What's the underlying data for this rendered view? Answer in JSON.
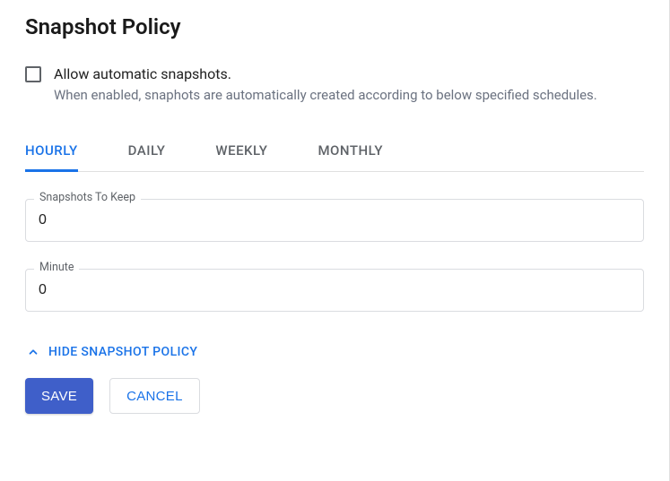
{
  "title": "Snapshot Policy",
  "allow_automatic": {
    "checked": false,
    "label": "Allow automatic snapshots.",
    "description": "When enabled, snaphots are automatically created according to below specified schedules."
  },
  "tabs": [
    {
      "label": "HOURLY",
      "active": true
    },
    {
      "label": "DAILY",
      "active": false
    },
    {
      "label": "WEEKLY",
      "active": false
    },
    {
      "label": "MONTHLY",
      "active": false
    }
  ],
  "fields": {
    "snapshots_to_keep": {
      "label": "Snapshots To Keep",
      "value": "0"
    },
    "minute": {
      "label": "Minute",
      "value": "0"
    }
  },
  "toggle": {
    "label": "HIDE SNAPSHOT POLICY",
    "expanded": true
  },
  "buttons": {
    "save": "SAVE",
    "cancel": "CANCEL"
  }
}
